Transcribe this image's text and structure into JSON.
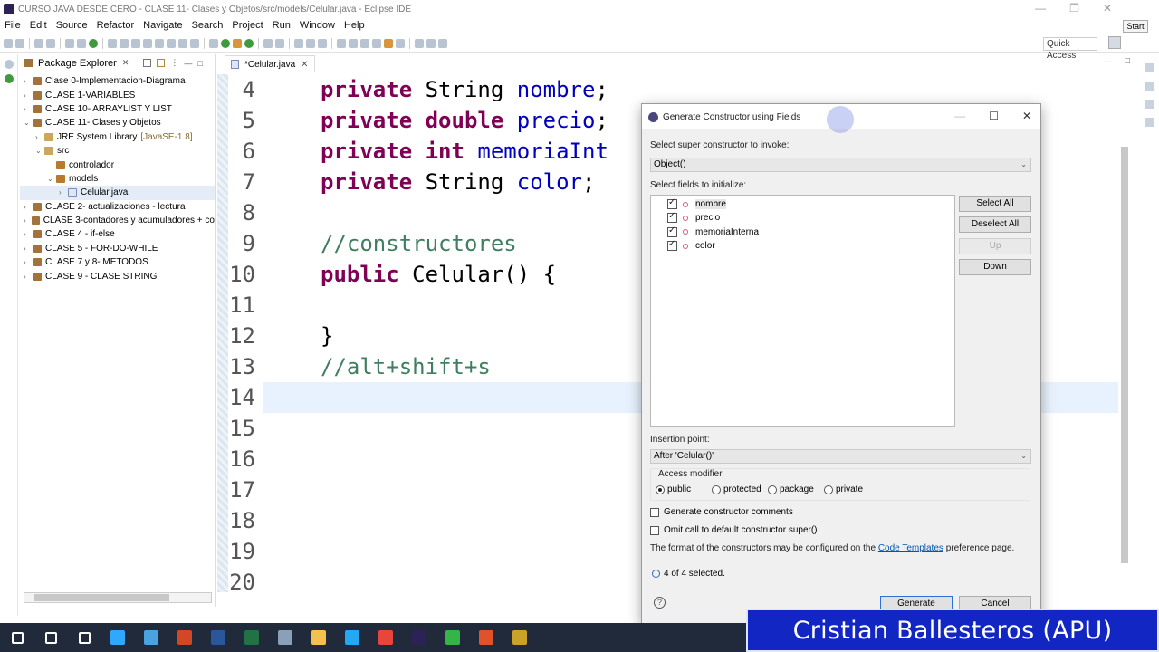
{
  "window": {
    "title": "CURSO JAVA  DESDE CERO - CLASE 11- Clases y Objetos/src/models/Celular.java - Eclipse IDE"
  },
  "menu": [
    "File",
    "Edit",
    "Source",
    "Refactor",
    "Navigate",
    "Search",
    "Project",
    "Run",
    "Window",
    "Help"
  ],
  "toolbar": {
    "start_label": "Start",
    "quick_access": "Quick Access"
  },
  "package_explorer": {
    "title": "Package Explorer",
    "nodes": [
      {
        "label": "Clase 0-Implementacion-Diagrama",
        "indent": 0,
        "arrow": "›",
        "icon": "proj"
      },
      {
        "label": "CLASE 1-VARIABLES",
        "indent": 0,
        "arrow": "›",
        "icon": "proj"
      },
      {
        "label": "CLASE 10- ARRAYLIST Y LIST",
        "indent": 0,
        "arrow": "›",
        "icon": "proj"
      },
      {
        "label": "CLASE 11- Clases y Objetos",
        "indent": 0,
        "arrow": "⌄",
        "icon": "proj"
      },
      {
        "label": "JRE System Library",
        "sub": "[JavaSE-1.8]",
        "indent": 1,
        "arrow": "›",
        "icon": "lib"
      },
      {
        "label": "src",
        "indent": 1,
        "arrow": "⌄",
        "icon": "fold"
      },
      {
        "label": "controlador",
        "indent": 2,
        "arrow": "",
        "icon": "pkg"
      },
      {
        "label": "models",
        "indent": 2,
        "arrow": "⌄",
        "icon": "pkg"
      },
      {
        "label": "Celular.java",
        "indent": 3,
        "arrow": "›",
        "icon": "java"
      },
      {
        "label": "CLASE 2- actualizaciones - lectura",
        "indent": 0,
        "arrow": "›",
        "icon": "proj"
      },
      {
        "label": "CLASE 3-contadores y acumuladores + co",
        "indent": 0,
        "arrow": "›",
        "icon": "proj"
      },
      {
        "label": "CLASE 4 - if-else",
        "indent": 0,
        "arrow": "›",
        "icon": "proj"
      },
      {
        "label": "CLASE 5 - FOR-DO-WHILE",
        "indent": 0,
        "arrow": "›",
        "icon": "proj"
      },
      {
        "label": "CLASE 7 y 8- METODOS",
        "indent": 0,
        "arrow": "›",
        "icon": "proj"
      },
      {
        "label": "CLASE 9 - CLASE STRING",
        "indent": 0,
        "arrow": "›",
        "icon": "proj"
      }
    ]
  },
  "editor": {
    "tab": "*Celular.java",
    "line_numbers": [
      "4",
      "5",
      "6",
      "7",
      "8",
      "9",
      "10",
      "11",
      "12",
      "13",
      "14",
      "15",
      "16",
      "17",
      "18",
      "19",
      "20"
    ],
    "lines": [
      {
        "kw1": "private",
        "type": " String ",
        "field": "nombre",
        "rest": ";"
      },
      {
        "kw1": "private",
        "kw2": " double",
        "type": " ",
        "field": "precio",
        "rest": ";"
      },
      {
        "kw1": "private",
        "kw2": " int",
        "type": " ",
        "field": "memoriaInt",
        "rest": ""
      },
      {
        "kw1": "private",
        "type": " String ",
        "field": "color",
        "rest": ";"
      },
      {},
      {
        "comment": "//constructores"
      },
      {
        "kw1": "public",
        "type": " Celular() {"
      },
      {},
      {
        "type": "}"
      },
      {
        "comment": "//alt+shift+s"
      },
      {},
      {},
      {},
      {},
      {},
      {},
      {}
    ]
  },
  "dialog": {
    "title": "Generate Constructor using Fields",
    "super_label": "Select super constructor to invoke:",
    "super_value": "Object()",
    "fields_label": "Select fields to initialize:",
    "fields": [
      {
        "name": "nombre",
        "checked": true
      },
      {
        "name": "precio",
        "checked": true
      },
      {
        "name": "memoriaInterna",
        "checked": true
      },
      {
        "name": "color",
        "checked": true
      }
    ],
    "buttons": {
      "select_all": "Select All",
      "deselect_all": "Deselect All",
      "up": "Up",
      "down": "Down",
      "generate": "Generate",
      "cancel": "Cancel"
    },
    "insertion_label": "Insertion point:",
    "insertion_value": "After 'Celular()'",
    "access_label": "Access modifier",
    "access_options": [
      "public",
      "protected",
      "package",
      "private"
    ],
    "access_selected": "public",
    "gen_comments": "Generate constructor comments",
    "omit_super": "Omit call to default constructor super()",
    "note_pre": "The format of the constructors may be configured on the",
    "note_link": "Code Templates",
    "note_post": "preference page.",
    "status": "4 of 4 selected."
  },
  "taskbar": {
    "icons": [
      "windows-start",
      "search",
      "task-view",
      "photoshop",
      "snipping",
      "powerpoint",
      "word",
      "excel",
      "tool",
      "file-explorer",
      "vscode",
      "chrome",
      "eclipse",
      "camtasia",
      "camtasia-recorder",
      "photos"
    ],
    "colors": [
      "#ffffff",
      "#ffffff",
      "#ffffff",
      "#31a8ff",
      "#4aa3df",
      "#d24726",
      "#2b579a",
      "#217346",
      "#8aa0b8",
      "#f2c14e",
      "#23a9f2",
      "#e8453c",
      "#2c2255",
      "#35b44a",
      "#e0522b",
      "#c9a227"
    ]
  },
  "banner": "Cristian Ballesteros (APU)"
}
